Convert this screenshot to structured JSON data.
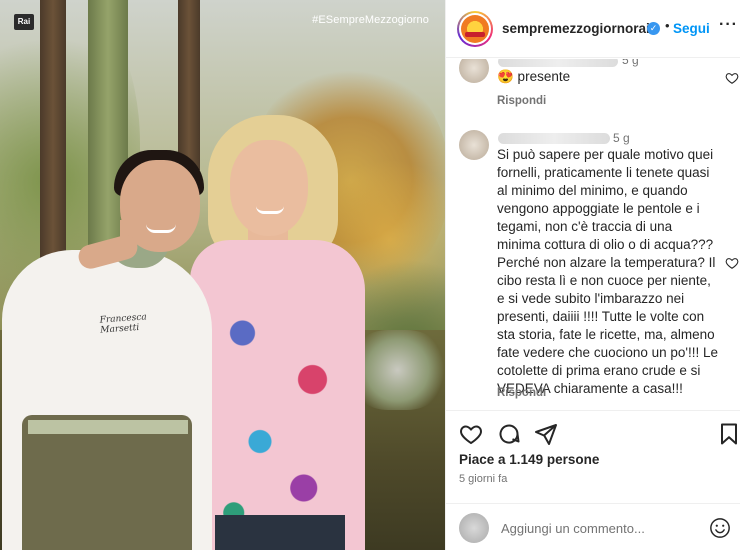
{
  "photo": {
    "channel_logo": "Rai",
    "hashtag": "#ESempreMezzogiorno",
    "chef_embroidery_1": "Francesca",
    "chef_embroidery_2": "Marsetti"
  },
  "header": {
    "username": "sempremezzogiornorai",
    "verified": true,
    "follow_label": "Segui",
    "more_label": "···"
  },
  "comments": [
    {
      "time": "5 g",
      "text": "😍 presente",
      "reply_label": "Rispondi"
    },
    {
      "time": "5 g",
      "lines": [
        "Si può sapere per quale motivo quei",
        "fornelli, praticamente li tenete quasi",
        "al minimo del minimo, e quando",
        "vengono appoggiate le pentole e i",
        "tegami, non c'è traccia di una",
        "minima cottura di olio o di acqua???",
        "Perché non alzare la temperatura? Il",
        "cibo resta lì e non cuoce per niente,",
        "e si vede subito l'imbarazzo nei",
        "presenti, daiiii !!!! Tutte le volte con",
        "sta storia, fate le ricette, ma, almeno",
        "fate vedere che cuociono un po'!!! Le",
        "cotolette di prima erano crude e si",
        "VEDEVA chiaramente a casa!!!"
      ],
      "reply_label": "Rispondi"
    }
  ],
  "footer": {
    "likes": "Piace a 1.149 persone",
    "time_ago": "5 giorni fa",
    "add_comment_placeholder": "Aggiungi un commento..."
  },
  "icons": [
    "heart-icon",
    "comment-icon",
    "share-icon",
    "bookmark-icon",
    "emoji-icon",
    "verified-icon"
  ],
  "colors": {
    "link_blue": "#0095f6",
    "verified_blue": "#3897f0",
    "muted_gray": "#737373"
  }
}
